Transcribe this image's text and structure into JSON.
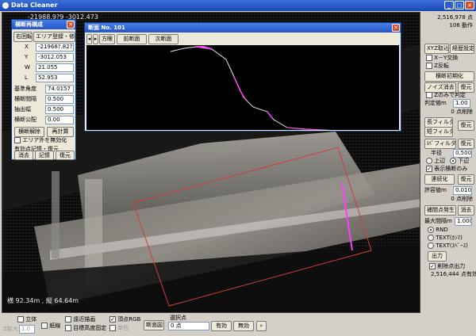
{
  "window": {
    "title": "Data Cleaner"
  },
  "viewport": {
    "coord_top": "-21988.9?9    -3012.473",
    "scale_text": "横 92.34m , 縦 64.64m"
  },
  "dialog_recon": {
    "title": "横断再構成",
    "btn_right_rotate": "右回転",
    "btn_area_reg": "エリア登録・修正",
    "x_label": "X",
    "x_value": "-21968?.82?",
    "y_label": "Y",
    "y_value": "-3012.053",
    "w_label": "W",
    "w_value": "21.055",
    "l_label": "L",
    "l_value": "52.953",
    "base_angle_label": "基準角度",
    "base_angle_value": "74.0157",
    "cross_interval_label": "横断間隔",
    "cross_interval_value": "0.500",
    "extract_width_label": "抽出幅",
    "extract_width_value": "0.500",
    "cross_offset_label": "横断公配",
    "cross_offset_value": "0.00",
    "btn_cancel_cross": "横断解除",
    "btn_recalc": "再計算",
    "chk_outside_label": "エリア外を無効化",
    "note_label": "有効点記憶・復元",
    "btn_clear": "消去",
    "btn_memory": "記憶",
    "btn_restore": "復元"
  },
  "dialog_section": {
    "title": "断面 No. 101",
    "btn_direction": "方眼",
    "btn_prev": "前断面",
    "btn_next": "次断面"
  },
  "right_panel": {
    "point_count": "2,516,978 点",
    "file_count": "106 動作",
    "btn_xyz_import": "XYZ取込",
    "btn_settings": "経歴設定",
    "chk_xy_swap": "X－Y交換",
    "chk_z_flip": "Z反転",
    "btn_cross_init": "横断初期化",
    "btn_noise_clear": "ノイズ消去",
    "btn_restore1": "復元",
    "chk_z_only": "Zのみで判定",
    "judge_label": "判定値m",
    "judge_value": "1.00",
    "delete_count1": "0 点削除",
    "btn_long_filter": "長フィルタ",
    "btn_short_filter": "短フィルタ",
    "btn_restore2": "復元",
    "btn_ifilter": "Iﾊﾟフィルタ",
    "btn_restore3": "復元",
    "radius_label": "半径",
    "radius_value": "0.500",
    "radio_upper": "上辺",
    "radio_lower": "下辺",
    "chk_show_cross": "表示横断のみ",
    "btn_continuous": "連続化",
    "btn_restore4": "復元",
    "tolerance_label": "許容値m",
    "tolerance_value": "0.010",
    "delete_count2": "0 点削除",
    "btn_interp": "補間点発生",
    "btn_erase": "消去",
    "max_interval_label": "最大間隔m",
    "max_interval_value": "1.000",
    "radio_rnd": "RND",
    "radio_text_comma": "TEXT(ｶﾝﾏ)",
    "radio_text_space": "TEXT(ｽﾍﾟｰｽ)",
    "btn_output": "出力",
    "chk_delete_output": "削除点出力",
    "valid_count": "2,516,444 点有効"
  },
  "bottom": {
    "chk_3d": "立体",
    "zoom_label": "Z拡大",
    "zoom_value": "1.0",
    "chk_contour": "紙線",
    "chk_far_draw": "遠近描画",
    "chk_target_height": "目標高度固定",
    "chk_vertex_rgb": "頂点RGB",
    "chk_monochrome": "単色",
    "btn_section_view": "断面図",
    "selected_label": "選択点",
    "selected_count": "0 点",
    "btn_valid": "有効",
    "btn_invalid": "無効"
  },
  "colors": {
    "title_blue": "#1c48b8",
    "highlight_magenta": "#ff3cff",
    "area_red": "#d23c3c",
    "profile_white": "#e6e6e6"
  }
}
